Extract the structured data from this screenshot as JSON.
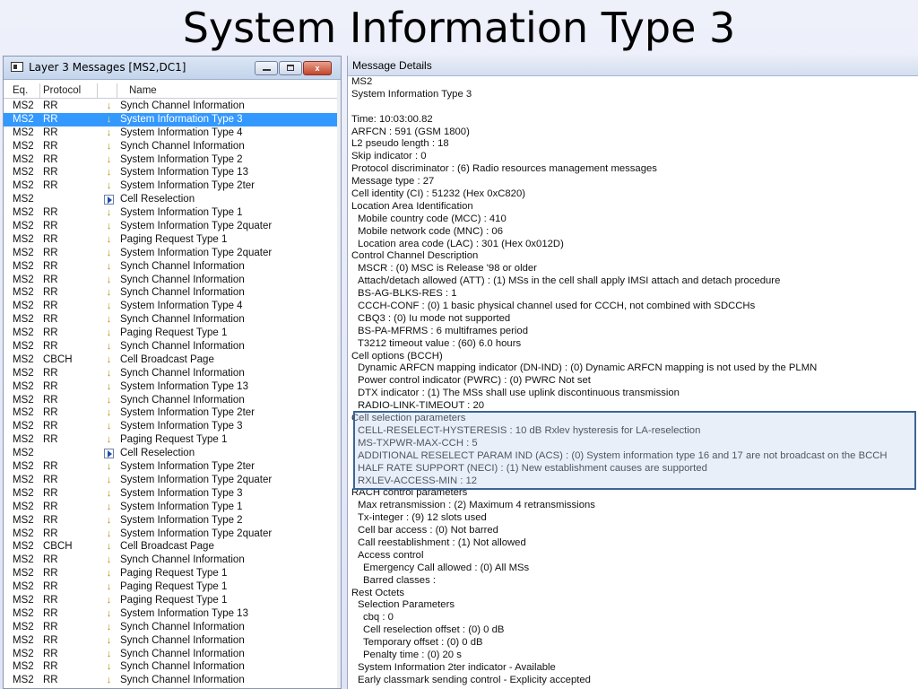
{
  "slide": {
    "title": "System Information Type 3"
  },
  "messages_window": {
    "title": "Layer 3 Messages  [MS2,DC1]",
    "columns": {
      "eq": "Eq.",
      "protocol": "Protocol",
      "name": "Name"
    },
    "close_glyph": "x",
    "selected_index": 1,
    "rows": [
      {
        "eq": "MS2",
        "protocol": "RR",
        "icon": "arrow-down-icon",
        "name": "Synch Channel Information"
      },
      {
        "eq": "MS2",
        "protocol": "RR",
        "icon": "arrow-down-icon",
        "name": "System Information Type 3"
      },
      {
        "eq": "MS2",
        "protocol": "RR",
        "icon": "arrow-down-icon",
        "name": "System Information Type 4"
      },
      {
        "eq": "MS2",
        "protocol": "RR",
        "icon": "arrow-down-icon",
        "name": "Synch Channel Information"
      },
      {
        "eq": "MS2",
        "protocol": "RR",
        "icon": "arrow-down-icon",
        "name": "System Information Type 2"
      },
      {
        "eq": "MS2",
        "protocol": "RR",
        "icon": "arrow-down-icon",
        "name": "System Information Type 13"
      },
      {
        "eq": "MS2",
        "protocol": "RR",
        "icon": "arrow-down-icon",
        "name": "System Information Type 2ter"
      },
      {
        "eq": "MS2",
        "protocol": "",
        "icon": "play-icon",
        "name": "Cell Reselection"
      },
      {
        "eq": "MS2",
        "protocol": "RR",
        "icon": "arrow-down-icon",
        "name": "System Information Type 1"
      },
      {
        "eq": "MS2",
        "protocol": "RR",
        "icon": "arrow-down-icon",
        "name": "System Information Type 2quater"
      },
      {
        "eq": "MS2",
        "protocol": "RR",
        "icon": "arrow-down-icon",
        "name": "Paging Request Type 1"
      },
      {
        "eq": "MS2",
        "protocol": "RR",
        "icon": "arrow-down-icon",
        "name": "System Information Type 2quater"
      },
      {
        "eq": "MS2",
        "protocol": "RR",
        "icon": "arrow-down-icon",
        "name": "Synch Channel Information"
      },
      {
        "eq": "MS2",
        "protocol": "RR",
        "icon": "arrow-down-icon",
        "name": "Synch Channel Information"
      },
      {
        "eq": "MS2",
        "protocol": "RR",
        "icon": "arrow-down-icon",
        "name": "Synch Channel Information"
      },
      {
        "eq": "MS2",
        "protocol": "RR",
        "icon": "arrow-down-icon",
        "name": "System Information Type 4"
      },
      {
        "eq": "MS2",
        "protocol": "RR",
        "icon": "arrow-down-icon",
        "name": "Synch Channel Information"
      },
      {
        "eq": "MS2",
        "protocol": "RR",
        "icon": "arrow-down-icon",
        "name": "Paging Request Type 1"
      },
      {
        "eq": "MS2",
        "protocol": "RR",
        "icon": "arrow-down-icon",
        "name": "Synch Channel Information"
      },
      {
        "eq": "MS2",
        "protocol": "CBCH",
        "icon": "arrow-down-icon",
        "name": "Cell Broadcast Page"
      },
      {
        "eq": "MS2",
        "protocol": "RR",
        "icon": "arrow-down-icon",
        "name": "Synch Channel Information"
      },
      {
        "eq": "MS2",
        "protocol": "RR",
        "icon": "arrow-down-icon",
        "name": "System Information Type 13"
      },
      {
        "eq": "MS2",
        "protocol": "RR",
        "icon": "arrow-down-icon",
        "name": "Synch Channel Information"
      },
      {
        "eq": "MS2",
        "protocol": "RR",
        "icon": "arrow-down-icon",
        "name": "System Information Type 2ter"
      },
      {
        "eq": "MS2",
        "protocol": "RR",
        "icon": "arrow-down-icon",
        "name": "System Information Type 3"
      },
      {
        "eq": "MS2",
        "protocol": "RR",
        "icon": "arrow-down-icon",
        "name": "Paging Request Type 1"
      },
      {
        "eq": "MS2",
        "protocol": "",
        "icon": "play-icon",
        "name": "Cell Reselection"
      },
      {
        "eq": "MS2",
        "protocol": "RR",
        "icon": "arrow-down-icon",
        "name": "System Information Type 2ter"
      },
      {
        "eq": "MS2",
        "protocol": "RR",
        "icon": "arrow-down-icon",
        "name": "System Information Type 2quater"
      },
      {
        "eq": "MS2",
        "protocol": "RR",
        "icon": "arrow-down-icon",
        "name": "System Information Type 3"
      },
      {
        "eq": "MS2",
        "protocol": "RR",
        "icon": "arrow-down-icon",
        "name": "System Information Type 1"
      },
      {
        "eq": "MS2",
        "protocol": "RR",
        "icon": "arrow-down-icon",
        "name": "System Information Type 2"
      },
      {
        "eq": "MS2",
        "protocol": "RR",
        "icon": "arrow-down-icon",
        "name": "System Information Type 2quater"
      },
      {
        "eq": "MS2",
        "protocol": "CBCH",
        "icon": "arrow-down-icon",
        "name": "Cell Broadcast Page"
      },
      {
        "eq": "MS2",
        "protocol": "RR",
        "icon": "arrow-down-icon",
        "name": "Synch Channel Information"
      },
      {
        "eq": "MS2",
        "protocol": "RR",
        "icon": "arrow-down-icon",
        "name": "Paging Request Type 1"
      },
      {
        "eq": "MS2",
        "protocol": "RR",
        "icon": "arrow-down-icon",
        "name": "Paging Request Type 1"
      },
      {
        "eq": "MS2",
        "protocol": "RR",
        "icon": "arrow-down-icon",
        "name": "Paging Request Type 1"
      },
      {
        "eq": "MS2",
        "protocol": "RR",
        "icon": "arrow-down-icon",
        "name": "System Information Type 13"
      },
      {
        "eq": "MS2",
        "protocol": "RR",
        "icon": "arrow-down-icon",
        "name": "Synch Channel Information"
      },
      {
        "eq": "MS2",
        "protocol": "RR",
        "icon": "arrow-down-icon",
        "name": "Synch Channel Information"
      },
      {
        "eq": "MS2",
        "protocol": "RR",
        "icon": "arrow-down-icon",
        "name": "Synch Channel Information"
      },
      {
        "eq": "MS2",
        "protocol": "RR",
        "icon": "arrow-down-icon",
        "name": "Synch Channel Information"
      },
      {
        "eq": "MS2",
        "protocol": "RR",
        "icon": "arrow-down-icon",
        "name": "Synch Channel Information"
      }
    ]
  },
  "message_details": {
    "header": "Message Details",
    "highlight_from": 27,
    "highlight_to": 32,
    "lines": [
      {
        "text": "MS2",
        "indent": 0
      },
      {
        "text": "System Information Type 3",
        "indent": 0
      },
      {
        "text": "",
        "indent": 0
      },
      {
        "text": "Time: 10:03:00.82",
        "indent": 0
      },
      {
        "text": "ARFCN : 591 (GSM 1800)",
        "indent": 0
      },
      {
        "text": "L2 pseudo length : 18",
        "indent": 0
      },
      {
        "text": "Skip indicator : 0",
        "indent": 0
      },
      {
        "text": "Protocol discriminator : (6) Radio resources management messages",
        "indent": 0
      },
      {
        "text": "Message type : 27",
        "indent": 0
      },
      {
        "text": "Cell identity (CI) : 51232 (Hex 0xC820)",
        "indent": 0
      },
      {
        "text": "Location Area Identification",
        "indent": 0
      },
      {
        "text": "Mobile country code (MCC) : 410",
        "indent": 1
      },
      {
        "text": "Mobile network code (MNC) : 06",
        "indent": 1
      },
      {
        "text": "Location area code (LAC) : 301 (Hex 0x012D)",
        "indent": 1
      },
      {
        "text": "Control Channel Description",
        "indent": 0
      },
      {
        "text": "MSCR : (0) MSC is Release '98 or older",
        "indent": 1
      },
      {
        "text": "Attach/detach allowed (ATT) : (1) MSs in the cell shall apply IMSI attach and detach procedure",
        "indent": 1
      },
      {
        "text": "BS-AG-BLKS-RES : 1",
        "indent": 1
      },
      {
        "text": "CCCH-CONF : (0) 1 basic physical channel used for CCCH, not combined with SDCCHs",
        "indent": 1
      },
      {
        "text": "CBQ3 : (0) Iu mode not supported",
        "indent": 1
      },
      {
        "text": "BS-PA-MFRMS : 6 multiframes period",
        "indent": 1
      },
      {
        "text": "T3212 timeout value : (60) 6.0 hours",
        "indent": 1
      },
      {
        "text": "Cell options (BCCH)",
        "indent": 0
      },
      {
        "text": "Dynamic ARFCN mapping indicator (DN-IND) : (0) Dynamic ARFCN mapping is not used by the PLMN",
        "indent": 1
      },
      {
        "text": "Power control indicator (PWRC) : (0) PWRC Not set",
        "indent": 1
      },
      {
        "text": "DTX indicator : (1) The MSs shall use uplink discontinuous transmission",
        "indent": 1
      },
      {
        "text": "RADIO-LINK-TIMEOUT : 20",
        "indent": 1
      },
      {
        "text": "Cell selection parameters",
        "indent": 0
      },
      {
        "text": "CELL-RESELECT-HYSTERESIS : 10 dB Rxlev hysteresis for LA-reselection",
        "indent": 1
      },
      {
        "text": "MS-TXPWR-MAX-CCH : 5",
        "indent": 1
      },
      {
        "text": "ADDITIONAL RESELECT PARAM IND (ACS) : (0) System information type 16 and 17 are not broadcast on the BCCH",
        "indent": 1
      },
      {
        "text": "HALF RATE SUPPORT (NECI) : (1) New establishment causes are supported",
        "indent": 1
      },
      {
        "text": "RXLEV-ACCESS-MIN : 12",
        "indent": 1
      },
      {
        "text": "RACH control parameters",
        "indent": 0
      },
      {
        "text": "Max retransmission : (2) Maximum 4 retransmissions",
        "indent": 1
      },
      {
        "text": "Tx-integer : (9) 12 slots used",
        "indent": 1
      },
      {
        "text": "Cell bar access : (0) Not barred",
        "indent": 1
      },
      {
        "text": "Call reestablishment : (1) Not allowed",
        "indent": 1
      },
      {
        "text": "Access control",
        "indent": 1
      },
      {
        "text": "Emergency Call allowed : (0) All MSs",
        "indent": 2
      },
      {
        "text": "Barred classes :",
        "indent": 2
      },
      {
        "text": "Rest Octets",
        "indent": 0
      },
      {
        "text": "Selection Parameters",
        "indent": 1
      },
      {
        "text": "cbq : 0",
        "indent": 2
      },
      {
        "text": "Cell reselection offset : (0) 0 dB",
        "indent": 2
      },
      {
        "text": "Temporary offset : (0) 0 dB",
        "indent": 2
      },
      {
        "text": "Penalty time : (0) 20 s",
        "indent": 2
      },
      {
        "text": "System Information 2ter indicator - Available",
        "indent": 1
      },
      {
        "text": "Early classmark sending control - Explicity accepted",
        "indent": 1
      }
    ]
  },
  "colors": {
    "selection": "#3399ff",
    "highlight_border": "#3d6496",
    "arrow_icon": "#b88a00"
  }
}
